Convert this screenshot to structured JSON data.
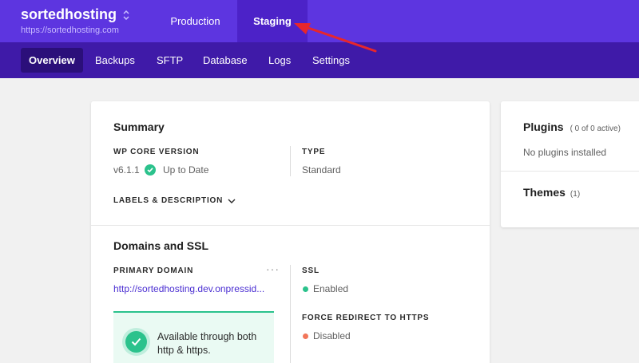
{
  "header": {
    "site_name": "sortedhosting",
    "site_url": "https://sortedhosting.com",
    "env_tabs": [
      {
        "label": "Production"
      },
      {
        "label": "Staging"
      }
    ]
  },
  "subnav": {
    "items": [
      {
        "label": "Overview"
      },
      {
        "label": "Backups"
      },
      {
        "label": "SFTP"
      },
      {
        "label": "Database"
      },
      {
        "label": "Logs"
      },
      {
        "label": "Settings"
      }
    ]
  },
  "summary": {
    "title": "Summary",
    "wp_core_label": "WP CORE VERSION",
    "wp_version": "v6.1.1",
    "wp_status": "Up to Date",
    "type_label": "TYPE",
    "type_value": "Standard",
    "labels_desc": "LABELS & DESCRIPTION"
  },
  "domains": {
    "title": "Domains and SSL",
    "primary_label": "PRIMARY DOMAIN",
    "primary_value": "http://sortedhosting.dev.onpressid...",
    "more": "···",
    "ssl_label": "SSL",
    "ssl_value": "Enabled",
    "redirect_label": "FORCE REDIRECT TO HTTPS",
    "redirect_value": "Disabled",
    "availability_text": "Available through both http & https."
  },
  "plugins": {
    "title": "Plugins",
    "count": "( 0 of 0 active)",
    "empty_text": "No plugins installed"
  },
  "themes": {
    "title": "Themes",
    "count": "(1)"
  },
  "colors": {
    "brand_purple": "#5d35e0",
    "subnav_purple": "#3f1aa8",
    "success_green": "#2bc28c",
    "disabled_orange": "#f2765a",
    "annotation_red": "#e8262b"
  }
}
